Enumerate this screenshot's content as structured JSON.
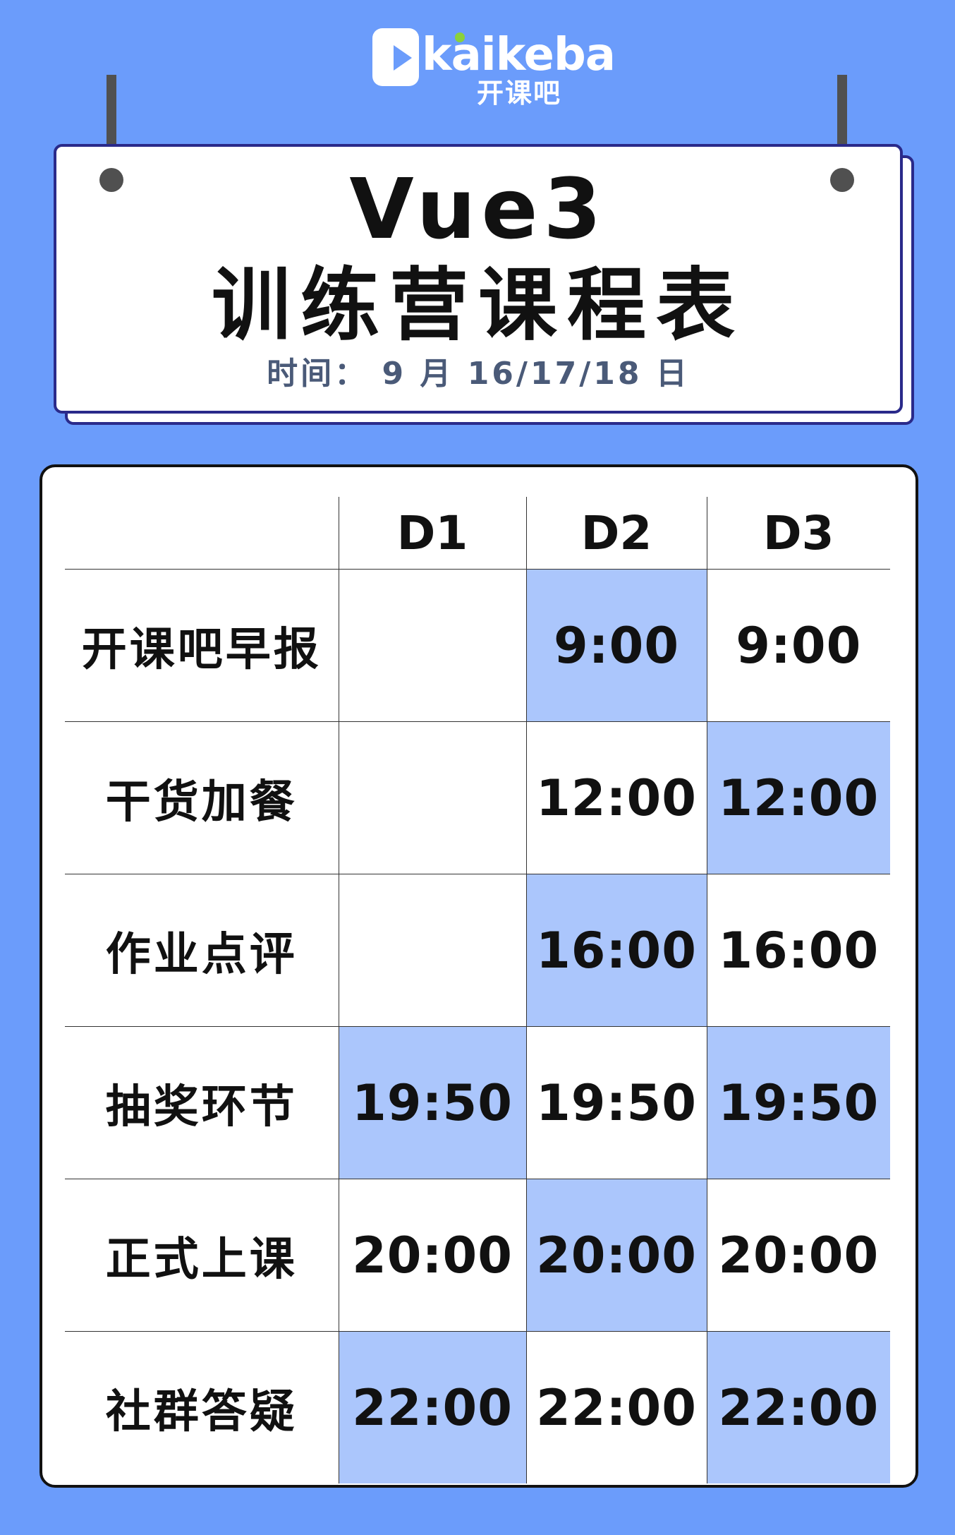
{
  "brand": {
    "logo_text": "kaikeba",
    "logo_sub": "开课吧"
  },
  "title": {
    "line1": "Vue3",
    "line2": "训练营课程表",
    "date": "时间： 9 月 16/17/18 日"
  },
  "colors": {
    "background": "#6b9cfb",
    "highlight": "#abc6fc",
    "card_border": "#2a2a8a"
  },
  "schedule": {
    "columns": [
      "D1",
      "D2",
      "D3"
    ],
    "rows": [
      {
        "label": "开课吧早报",
        "cells": [
          {
            "time": "",
            "highlight": false
          },
          {
            "time": "9:00",
            "highlight": true
          },
          {
            "time": "9:00",
            "highlight": false
          }
        ]
      },
      {
        "label": "干货加餐",
        "cells": [
          {
            "time": "",
            "highlight": false
          },
          {
            "time": "12:00",
            "highlight": false
          },
          {
            "time": "12:00",
            "highlight": true
          }
        ]
      },
      {
        "label": "作业点评",
        "cells": [
          {
            "time": "",
            "highlight": false
          },
          {
            "time": "16:00",
            "highlight": true
          },
          {
            "time": "16:00",
            "highlight": false
          }
        ]
      },
      {
        "label": "抽奖环节",
        "cells": [
          {
            "time": "19:50",
            "highlight": true
          },
          {
            "time": "19:50",
            "highlight": false
          },
          {
            "time": "19:50",
            "highlight": true
          }
        ]
      },
      {
        "label": "正式上课",
        "cells": [
          {
            "time": "20:00",
            "highlight": false
          },
          {
            "time": "20:00",
            "highlight": true
          },
          {
            "time": "20:00",
            "highlight": false
          }
        ]
      },
      {
        "label": "社群答疑",
        "cells": [
          {
            "time": "22:00",
            "highlight": true
          },
          {
            "time": "22:00",
            "highlight": false
          },
          {
            "time": "22:00",
            "highlight": true
          }
        ]
      }
    ]
  }
}
